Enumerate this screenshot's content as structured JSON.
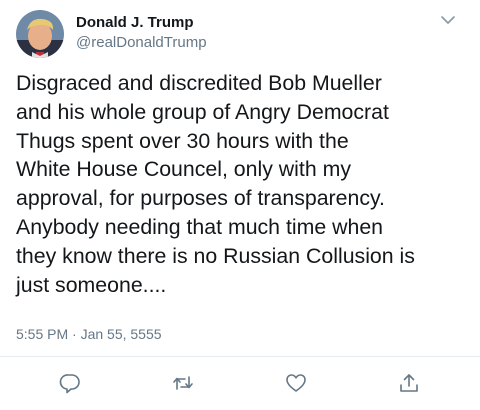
{
  "tweet": {
    "author": {
      "display_name": "Donald J. Trump",
      "handle": "@realDonaldTrump",
      "avatar_icon": "profile-photo"
    },
    "menu_icon": "chevron-down-icon",
    "text": "Disgraced and discredited Bob Mueller\nand his whole group of Angry Democrat\nThugs spent over 30 hours with the\nWhite House Councel, only with my\napproval, for purposes of transparency.\nAnybody needing that much time when\nthey know there is no Russian Collusion is\njust someone....",
    "timestamp": "5:55 PM · Jan 55, 5555",
    "actions": [
      {
        "name": "reply",
        "icon": "reply-icon"
      },
      {
        "name": "retweet",
        "icon": "retweet-icon"
      },
      {
        "name": "like",
        "icon": "heart-icon"
      },
      {
        "name": "share",
        "icon": "share-icon"
      }
    ]
  },
  "colors": {
    "text_primary": "#14171a",
    "text_secondary": "#657786",
    "divider": "#e6ecf0"
  }
}
